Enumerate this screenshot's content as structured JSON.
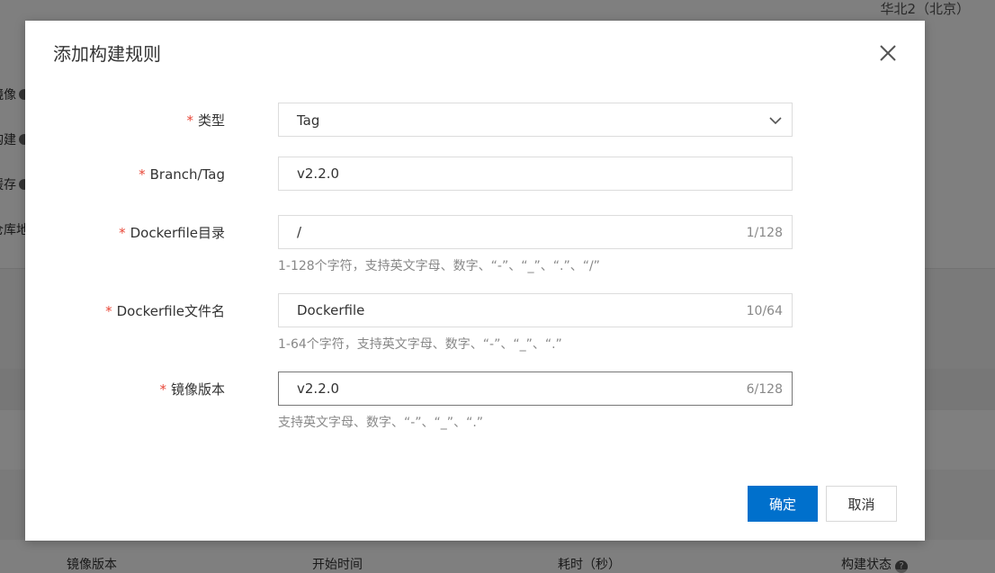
{
  "background": {
    "region": "华北2（北京）",
    "side_items": [
      "镜像",
      "构建",
      "缓存",
      "仓库地址"
    ],
    "table_headers": [
      "镜像版本",
      "开始时间",
      "耗时（秒）",
      "构建状态"
    ]
  },
  "modal": {
    "title": "添加构建规则",
    "fields": {
      "type": {
        "label": "类型",
        "value": "Tag"
      },
      "branch_tag": {
        "label": "Branch/Tag",
        "value": "v2.2.0"
      },
      "dockerfile_dir": {
        "label": "Dockerfile目录",
        "value": "/",
        "count": "1/128",
        "hint": "1-128个字符，支持英文字母、数字、“-”、“_”、“.”、“/”"
      },
      "dockerfile_name": {
        "label": "Dockerfile文件名",
        "value": "Dockerfile",
        "count": "10/64",
        "hint": "1-64个字符，支持英文字母、数字、“-”、“_”、“.”"
      },
      "image_version": {
        "label": "镜像版本",
        "value": "v2.2.0",
        "count": "6/128",
        "hint": "支持英文字母、数字、“-”、“_”、“.”"
      }
    },
    "required_mark": "*",
    "buttons": {
      "confirm": "确定",
      "cancel": "取消"
    }
  },
  "icons": {
    "close": "close-icon",
    "select": "chevron-down-icon",
    "help": "question-icon"
  },
  "colors": {
    "primary": "#0070cc",
    "required": "#e84738"
  }
}
